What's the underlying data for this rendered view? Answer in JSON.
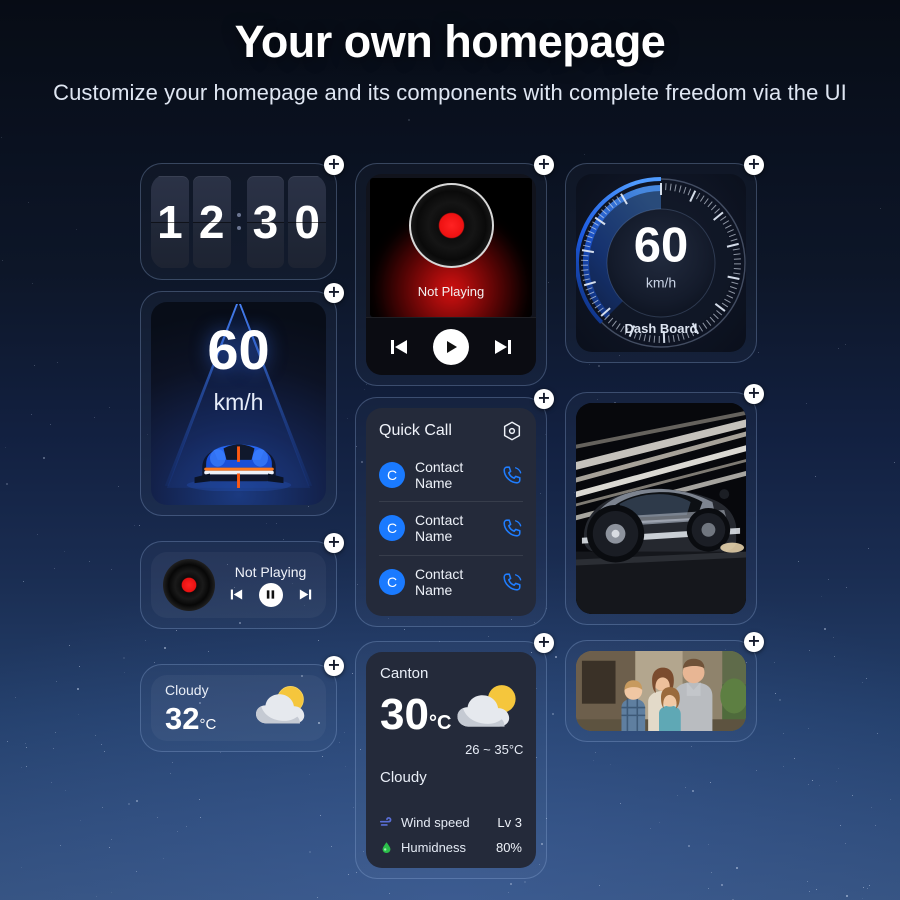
{
  "header": {
    "title": "Your own homepage",
    "subtitle": "Customize your homepage and its components with complete freedom via the UI"
  },
  "colors": {
    "accent_blue": "#1a7aff",
    "gauge_blue": "#2a7bff",
    "record_red": "#ee1111",
    "sun_yellow": "#f5c33b",
    "wind_icon": "#5a6fd8",
    "humidity_icon": "#2bbf4a",
    "bg_top": "#070c15",
    "bg_bottom": "#35527f"
  },
  "add_badge": {
    "glyph": "+",
    "label": "add-widget"
  },
  "widgets": {
    "clock": {
      "name": "Flip Clock",
      "digits": [
        "1",
        "2",
        "3",
        "0"
      ],
      "time": "12:30"
    },
    "speed": {
      "name": "Speed",
      "value": "60",
      "unit": "km/h"
    },
    "music_large": {
      "name": "Music Player",
      "status": "Not Playing",
      "controls": [
        "previous",
        "play",
        "next"
      ]
    },
    "music_small": {
      "name": "Mini Music Player",
      "status": "Not Playing",
      "controls": [
        "previous",
        "pause",
        "next"
      ]
    },
    "dashboard": {
      "name": "Dash Board",
      "value": "60",
      "unit": "km/h",
      "label": "Dash Board"
    },
    "quick_call": {
      "name": "Quick Call",
      "title": "Quick Call",
      "settings_icon": "hexagon-settings-icon",
      "contacts": [
        {
          "initial": "C",
          "name": "Contact Name",
          "action": "call"
        },
        {
          "initial": "C",
          "name": "Contact Name",
          "action": "call"
        },
        {
          "initial": "C",
          "name": "Contact Name",
          "action": "call"
        }
      ]
    },
    "car_photo": {
      "name": "Car Image",
      "alt": "silver sports car with light trails"
    },
    "weather_small": {
      "name": "Weather Compact",
      "condition": "Cloudy",
      "temperature": "32",
      "unit": "°C",
      "icon": "partly-cloudy-icon"
    },
    "weather_large": {
      "name": "Weather Detail",
      "city": "Canton",
      "temperature": "30",
      "unit": "°C",
      "range": "26 ~ 35°C",
      "condition": "Cloudy",
      "icon": "partly-cloudy-icon",
      "details": [
        {
          "icon": "wind-icon",
          "label": "Wind speed",
          "value": "Lv 3"
        },
        {
          "icon": "humidity-icon",
          "label": "Humidness",
          "value": "80%"
        }
      ]
    },
    "family_photo": {
      "name": "Photo Frame",
      "alt": "family portrait of four people outdoors"
    }
  }
}
